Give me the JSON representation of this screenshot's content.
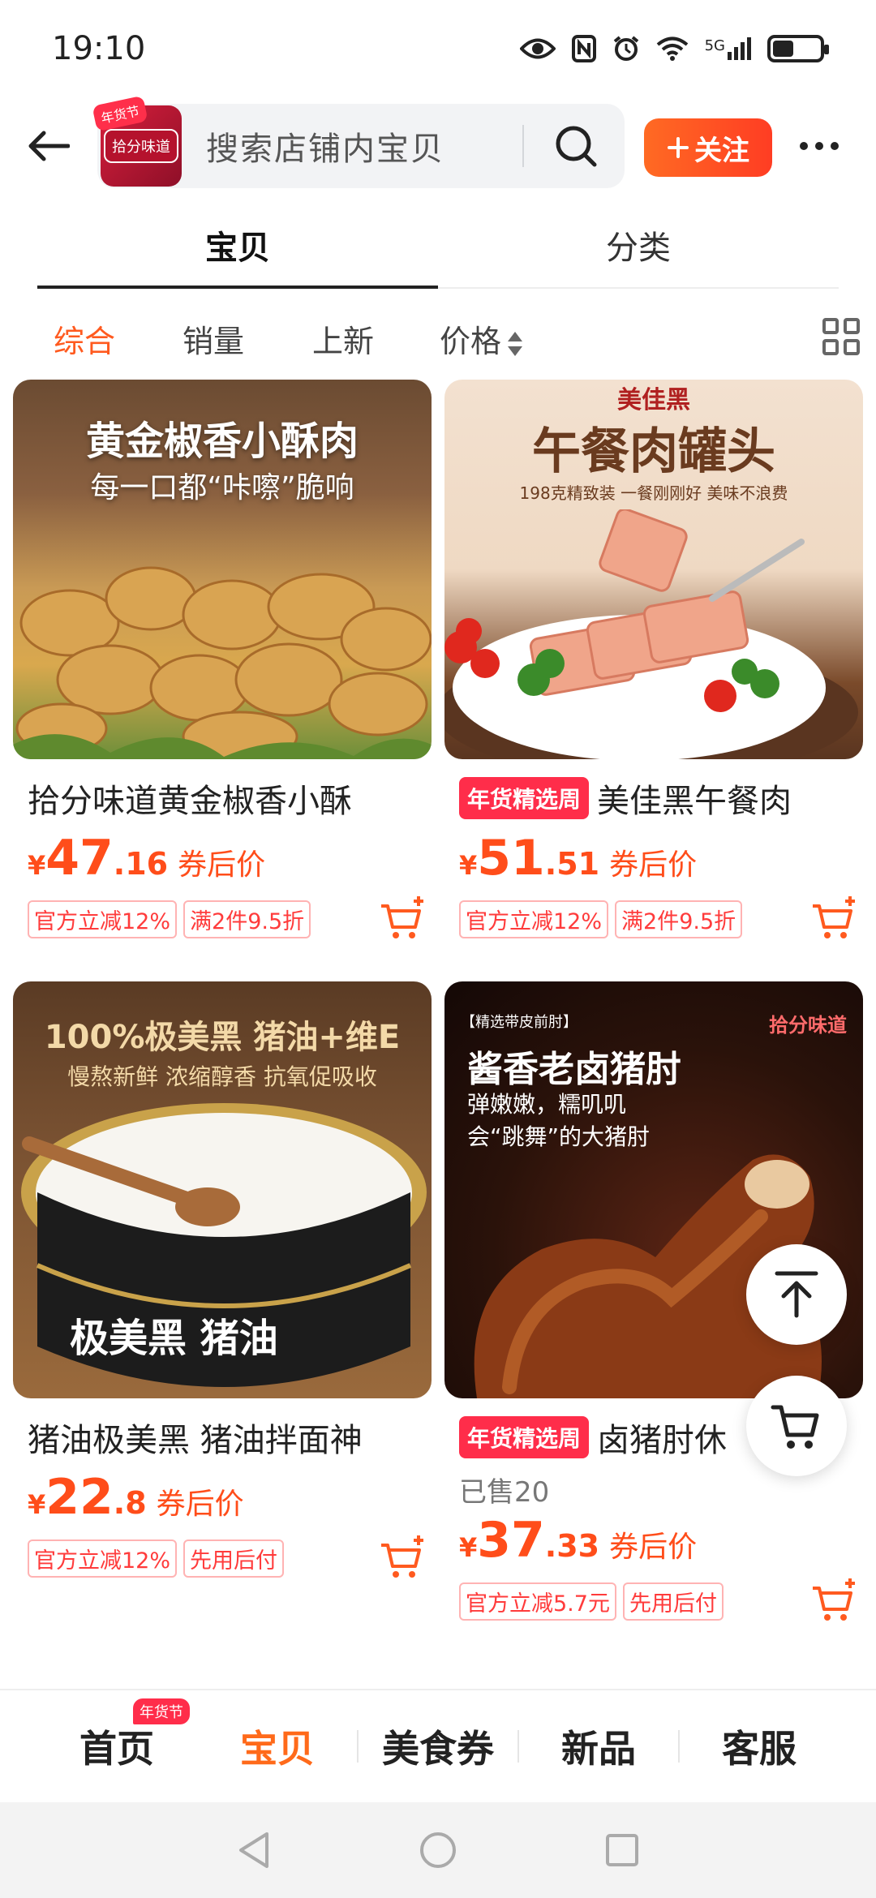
{
  "status_bar": {
    "time": "19:10",
    "icons": [
      "eye-icon",
      "nfc-icon",
      "alarm-icon",
      "wifi-icon",
      "signal-5g-icon",
      "battery-icon"
    ],
    "network_label": "5G",
    "battery_level": 0.4
  },
  "header": {
    "shop_logo_badge": "年货节",
    "shop_logo_text": "拾分味道",
    "search_placeholder": "搜索店铺内宝贝",
    "follow_label": "关注",
    "follow_icon": "plus-icon",
    "accent_color": "#ff5a1f"
  },
  "tabs": [
    {
      "label": "宝贝",
      "active": true
    },
    {
      "label": "分类",
      "active": false
    }
  ],
  "sort": {
    "items": [
      "综合",
      "销量",
      "上新",
      "价格"
    ],
    "active_index": 0
  },
  "products": [
    {
      "title": "拾分味道黄金椒香小酥",
      "promo_tag": "",
      "sold": "",
      "price_int": "47",
      "price_dec": ".16",
      "price_label": "券后价",
      "tags": [
        "官方立减12%",
        "满2件9.5折"
      ],
      "img_headline": "黄金椒香小酥肉",
      "img_sub": "每一口都“咔嚓”脆响",
      "img_caption": ""
    },
    {
      "title": "美佳黑午餐肉",
      "promo_tag": "年货精选周",
      "sold": "",
      "price_int": "51",
      "price_dec": ".51",
      "price_label": "券后价",
      "tags": [
        "官方立减12%",
        "满2件9.5折"
      ],
      "img_headline": "午餐肉罐头",
      "img_sub": "198克精致装 一餐刚刚好 美味不浪费",
      "img_caption": "美佳黑"
    },
    {
      "title": "猪油极美黑 猪油拌面神",
      "promo_tag": "",
      "sold": "",
      "price_int": "22",
      "price_dec": ".8",
      "price_label": "券后价",
      "tags": [
        "官方立减12%",
        "先用后付"
      ],
      "img_headline": "100%极美黑 猪油+维E",
      "img_sub": "慢熬新鲜  浓缩醇香  抗氧促吸收",
      "img_caption": "极美黑 猪油"
    },
    {
      "title": "卤猪肘休",
      "promo_tag": "年货精选周",
      "sold": "已售20",
      "price_int": "37",
      "price_dec": ".33",
      "price_label": "券后价",
      "tags": [
        "官方立减5.7元",
        "先用后付"
      ],
      "img_headline": "酱香老卤猪肘",
      "img_sub": "弹嫩嫩，糯叽叽",
      "img_caption": "会“跳舞”的大猪肘",
      "img_corner": "【精选带皮前肘】",
      "img_brand": "拾分味道"
    }
  ],
  "currency_symbol": "¥",
  "fabs": [
    "back-to-top-icon",
    "cart-icon"
  ],
  "bottom_nav": {
    "items": [
      "首页",
      "宝贝",
      "美食券",
      "新品",
      "客服"
    ],
    "active_index": 1,
    "badge": "年货节"
  }
}
